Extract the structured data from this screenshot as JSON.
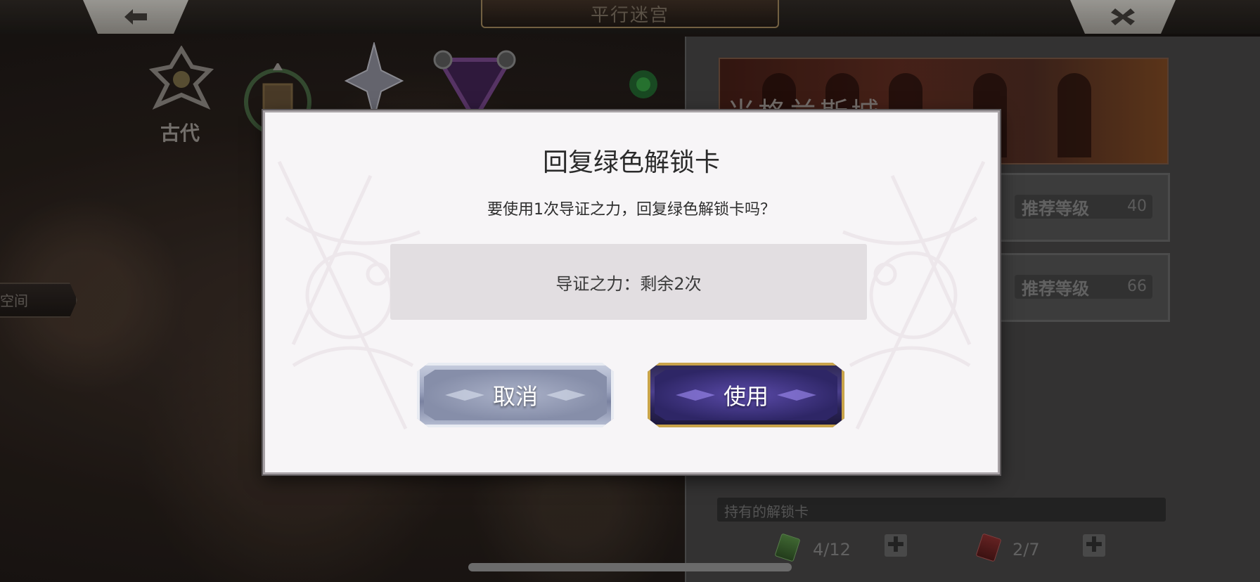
{
  "header": {
    "title": "平行迷宫",
    "back_icon": "arrow-left-icon",
    "close_icon": "close-icon"
  },
  "map": {
    "era_label": "古代",
    "side_tab_label": "空间"
  },
  "right_panel": {
    "stage_title": "米格兰斯城",
    "stages": [
      {
        "level_label": "推荐等级",
        "level_value": "40"
      },
      {
        "level_label": "推荐等级",
        "level_value": "66"
      }
    ],
    "cards_label": "持有的解锁卡",
    "cards": [
      {
        "color": "green",
        "count": "4/12"
      },
      {
        "color": "red",
        "count": "2/7"
      }
    ],
    "plus_symbol": "✚"
  },
  "dialog": {
    "title": "回复绿色解锁卡",
    "message": "要使用1次导证之力，回复绿色解锁卡吗？",
    "info": "导证之力：剩余2次",
    "cancel_label": "取消",
    "use_label": "使用"
  },
  "colors": {
    "dialog_bg": "#f7f5f7",
    "info_box_bg": "#e2dee1",
    "use_button_border": "#c9a44a",
    "use_button_fill": "#4b3f8c",
    "cancel_button_fill": "#9aa2bd"
  }
}
